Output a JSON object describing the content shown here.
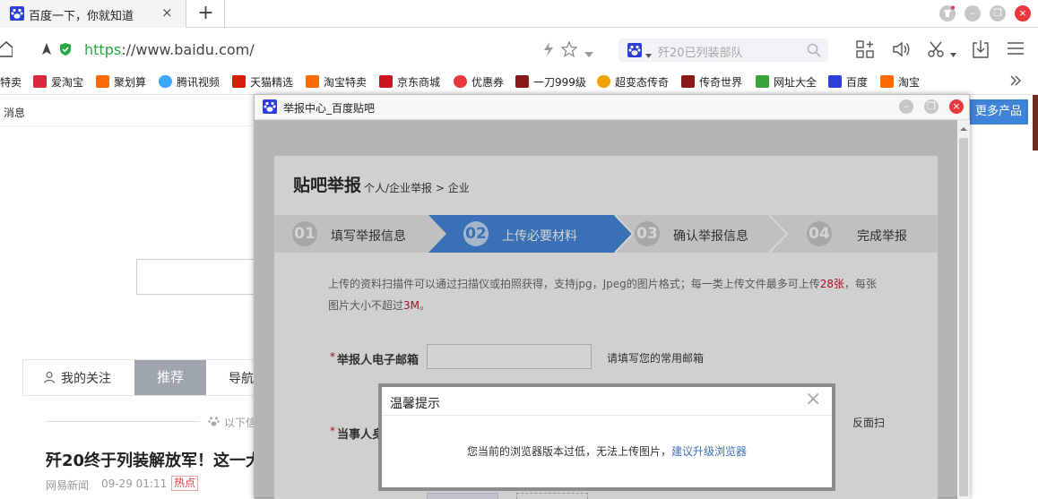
{
  "tab": {
    "title": "百度一下，你就知道",
    "close": "×",
    "new_tab": "+"
  },
  "window_controls": {
    "minimize": "–",
    "restore": "❐",
    "close": "×"
  },
  "address": {
    "url_secure": "https",
    "url_rest": "://www.baidu.com/",
    "search_placeholder": "歼20已列装部队"
  },
  "bookmarks": [
    {
      "label": "特卖",
      "color": "#ffffff"
    },
    {
      "label": "爱淘宝",
      "color": "#d9273b"
    },
    {
      "label": "聚划算",
      "color": "#ff6a00"
    },
    {
      "label": "腾讯视频",
      "color": "#3ca7ff"
    },
    {
      "label": "天猫精选",
      "color": "#d81e06"
    },
    {
      "label": "淘宝特卖",
      "color": "#ff6a00"
    },
    {
      "label": "京东商城",
      "color": "#c81623"
    },
    {
      "label": "优惠券",
      "color": "#e8383d"
    },
    {
      "label": "一刀999级",
      "color": "#8a1a1a"
    },
    {
      "label": "超变态传奇",
      "color": "#f2a200"
    },
    {
      "label": "传奇世界",
      "color": "#8a1a1a"
    },
    {
      "label": "网址大全",
      "color": "#3aa23a"
    },
    {
      "label": "百度",
      "color": "#2d3fd6"
    },
    {
      "label": "淘宝",
      "color": "#ff6a00"
    }
  ],
  "baidu_page": {
    "messages": "消息",
    "more_products": "更多产品",
    "tabs": {
      "follow": "我的关注",
      "recommend": "推荐",
      "nav": "导航"
    },
    "feed_divider": "以下信",
    "news_title": "歼20终于列装解放军！这一大",
    "news_source": "网易新闻",
    "news_time": "09-29 01:11",
    "news_badge": "热点"
  },
  "popup": {
    "title": "举报中心_百度贴吧",
    "heading": "贴吧举报",
    "breadcrumb": "个人/企业举报 > 企业",
    "steps": [
      {
        "num": "01",
        "label": "填写举报信息"
      },
      {
        "num": "02",
        "label": "上传必要材料"
      },
      {
        "num": "03",
        "label": "确认举报信息"
      },
      {
        "num": "04",
        "label": "完成举报"
      }
    ],
    "intro_a": "上传的资料扫描件可以通过扫描仪或拍照获得，支持jpg，Jpeg的图片格式；每一类上传文件最多可上传",
    "intro_limit": "28张",
    "intro_b": "，每张",
    "intro_c": "图片大小不超过",
    "intro_size": "3M",
    "intro_d": "。",
    "email_label": "举报人电子邮箱",
    "email_hint": "请填写您的常用邮箱",
    "party_label": "当事人身",
    "scan_hint": "反面扫",
    "required_mark": "*"
  },
  "dialog": {
    "title": "温馨提示",
    "message": "您当前的浏览器版本过低，无法上传图片，",
    "link": "建议升级浏览器",
    "close": "×"
  },
  "colors": {
    "accent_blue": "#3f83d9",
    "brand_blue": "#2d3fd6",
    "red": "#c30d23"
  }
}
